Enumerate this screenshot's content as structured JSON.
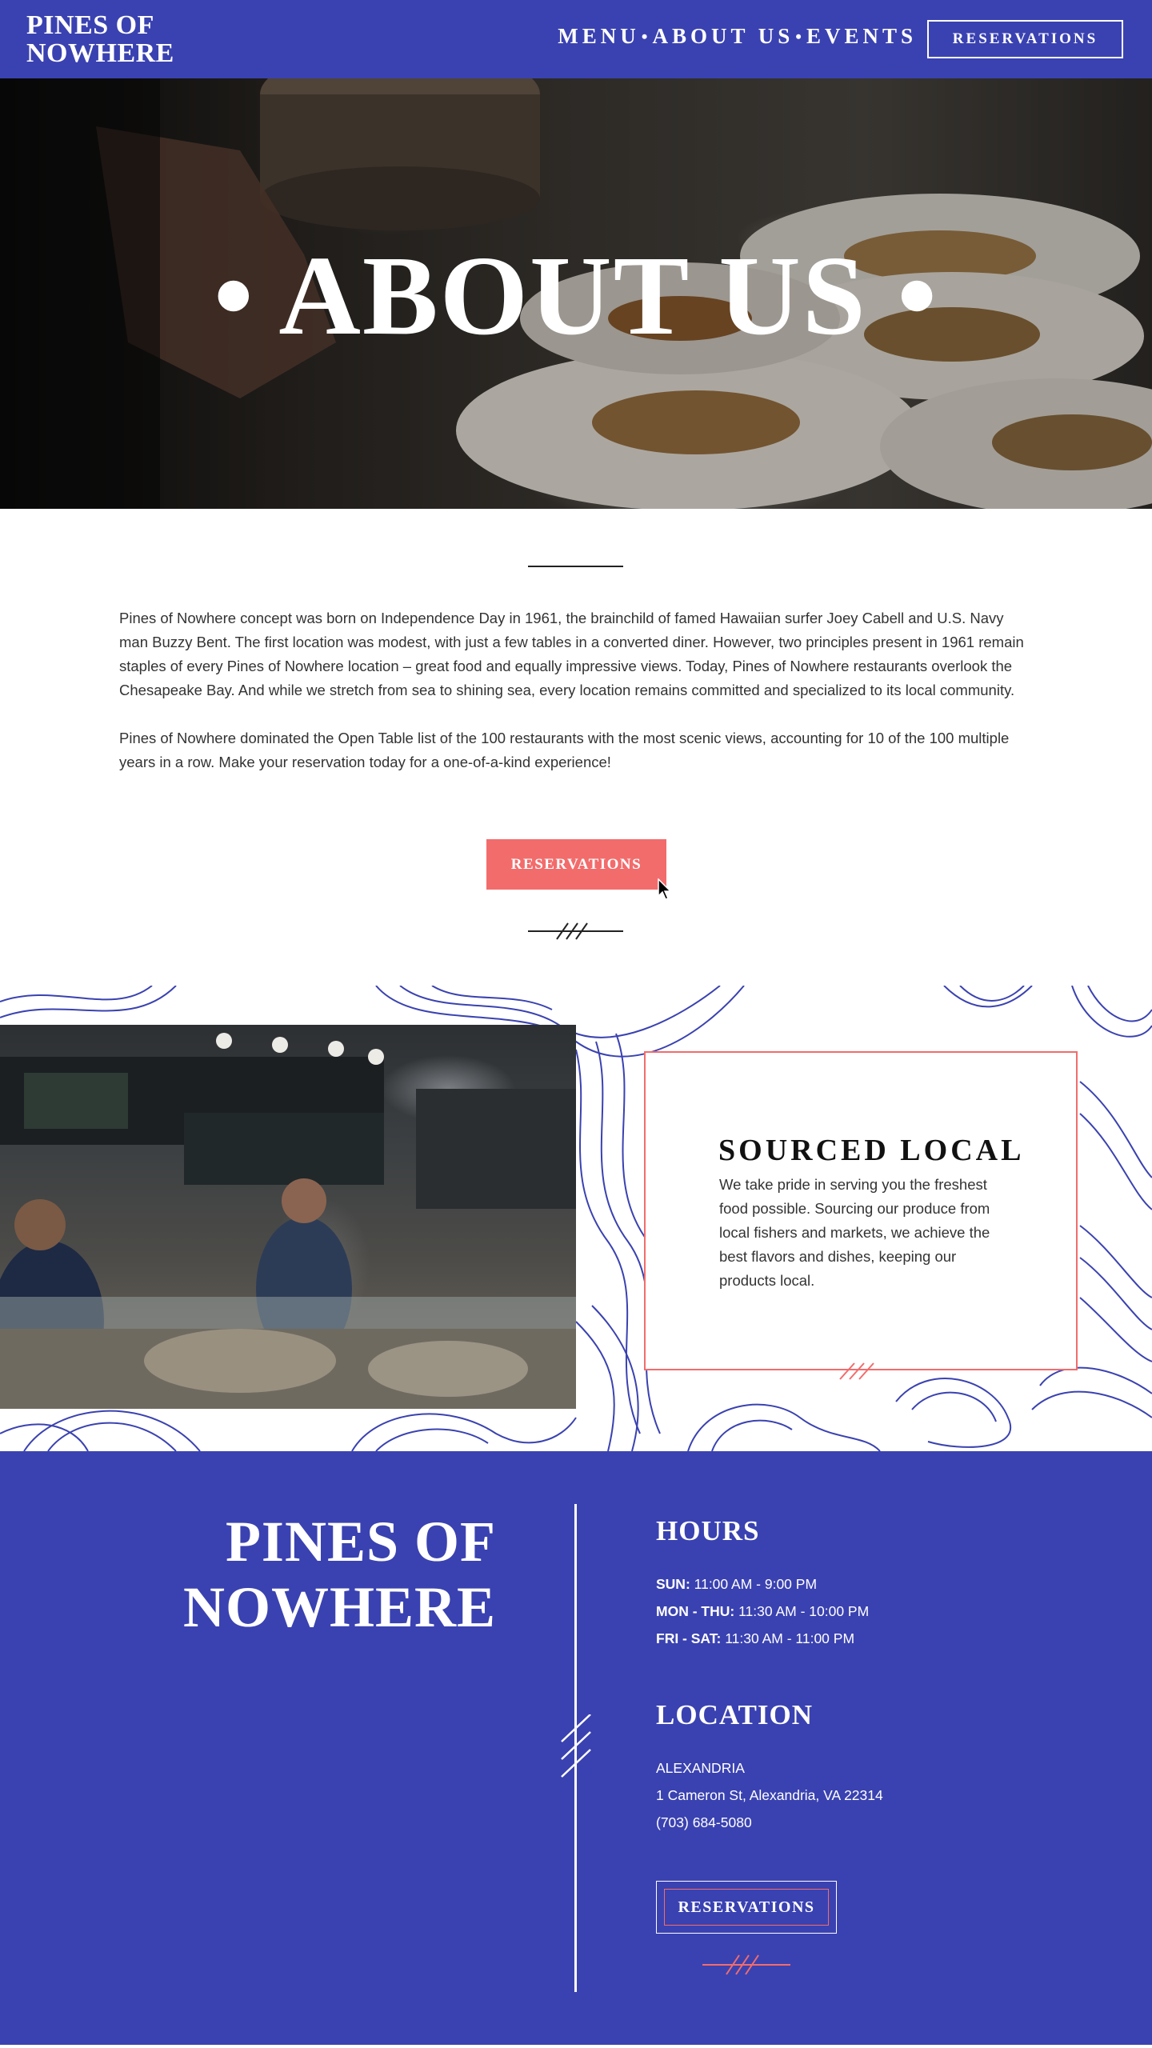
{
  "header": {
    "logo": "PINES OF NOWHERE",
    "nav": [
      "MENU",
      "ABOUT US",
      "EVENTS"
    ],
    "nav_separator": "•",
    "reservations_label": "RESERVATIONS"
  },
  "hero": {
    "title": "• ABOUT US •"
  },
  "about": {
    "paragraphs": [
      "Pines of Nowhere concept was born on Independence Day in 1961, the brainchild of famed Hawaiian surfer Joey Cabell and U.S. Navy man Buzzy Bent. The first location was modest, with just a few tables in a converted diner. However, two principles present in 1961 remain staples of every Pines of Nowhere location – great food and equally impressive views. Today, Pines of Nowhere restaurants overlook the Chesapeake Bay. And while we stretch from sea to shining sea, every location remains committed and specialized to its local community.",
      "Pines of Nowhere dominated the Open Table list of the 100 restaurants with the most scenic views, accounting for 10 of the 100 multiple years in a row. Make your reservation today for a one-of-a-kind experience!"
    ],
    "reservations_label": "RESERVATIONS"
  },
  "sourced": {
    "title": "SOURCED LOCAL",
    "text": "We take pride in serving you the freshest food possible. Sourcing our produce from local fishers and markets, we achieve the best flavors and dishes, keeping our products  local."
  },
  "footer": {
    "logo": "PINES OF NOWHERE",
    "hours_heading": "HOURS",
    "hours": [
      {
        "days": "SUN:",
        "time": "11:00 AM - 9:00 PM"
      },
      {
        "days": "MON - THU:",
        "time": "11:30 AM - 10:00 PM"
      },
      {
        "days": "FRI - SAT:",
        "time": "11:30 AM - 11:00 PM"
      }
    ],
    "location_heading": "LOCATION",
    "city": "ALEXANDRIA",
    "address": "1 Cameron St, Alexandria, VA 22314",
    "phone": "(703) 684-5080",
    "reservations_label": "RESERVATIONS"
  },
  "colors": {
    "brand_blue": "#3a42b1",
    "accent_coral": "#f26c6c"
  }
}
